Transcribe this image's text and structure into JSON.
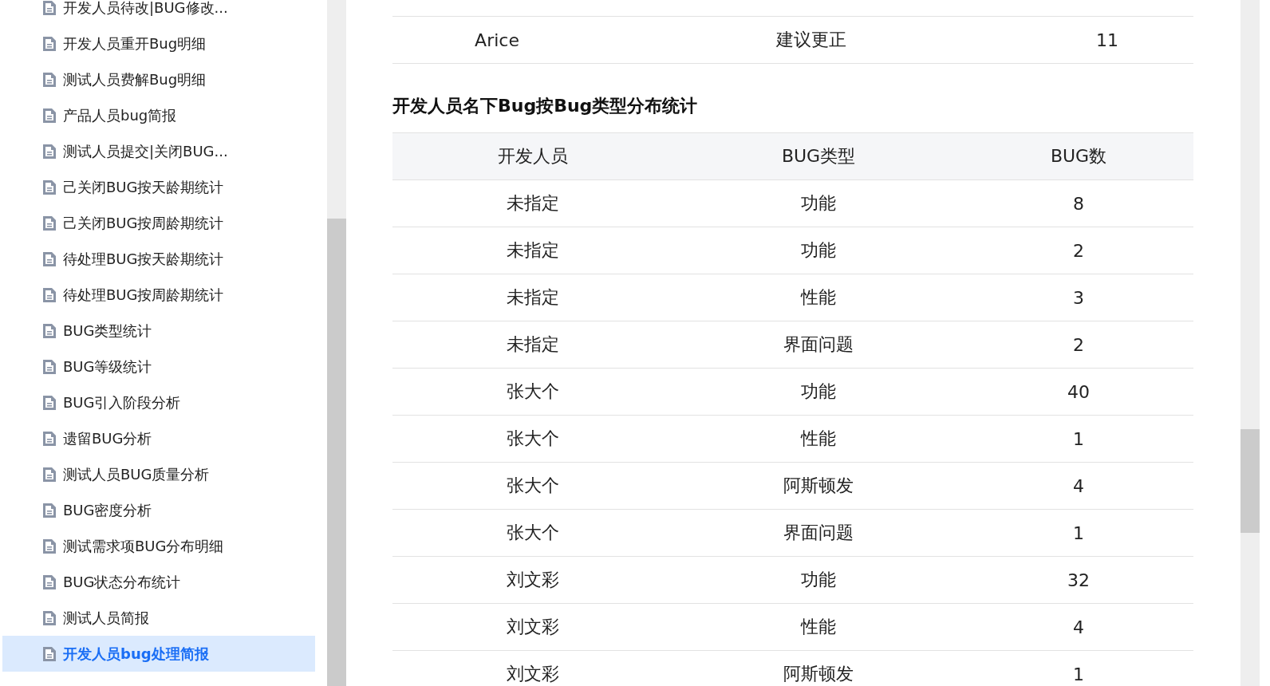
{
  "sidebar": {
    "items": [
      {
        "label": "开发人员待改|BUG修改...",
        "selected": false
      },
      {
        "label": "开发人员重开Bug明细",
        "selected": false
      },
      {
        "label": "测试人员费解Bug明细",
        "selected": false
      },
      {
        "label": "产品人员bug简报",
        "selected": false
      },
      {
        "label": "测试人员提交|关闭BUG...",
        "selected": false
      },
      {
        "label": "己关闭BUG按天龄期统计",
        "selected": false
      },
      {
        "label": "己关闭BUG按周龄期统计",
        "selected": false
      },
      {
        "label": "待处理BUG按天龄期统计",
        "selected": false
      },
      {
        "label": "待处理BUG按周龄期统计",
        "selected": false
      },
      {
        "label": "BUG类型统计",
        "selected": false
      },
      {
        "label": "BUG等级统计",
        "selected": false
      },
      {
        "label": "BUG引入阶段分析",
        "selected": false
      },
      {
        "label": "遗留BUG分析",
        "selected": false
      },
      {
        "label": "测试人员BUG质量分析",
        "selected": false
      },
      {
        "label": "BUG密度分析",
        "selected": false
      },
      {
        "label": "测试需求项BUG分布明细",
        "selected": false
      },
      {
        "label": "BUG状态分布统计",
        "selected": false
      },
      {
        "label": "测试人员简报",
        "selected": false
      },
      {
        "label": "开发人员bug处理简报",
        "selected": true
      }
    ]
  },
  "previous_table": {
    "rows": [
      [
        "Arice",
        "建议更正",
        "11"
      ]
    ]
  },
  "section": {
    "title": "开发人员名下Bug按Bug类型分布统计",
    "columns": [
      "开发人员",
      "BUG类型",
      "BUG数"
    ],
    "rows": [
      [
        "未指定",
        "功能",
        "8"
      ],
      [
        "未指定",
        "功能",
        "2"
      ],
      [
        "未指定",
        "性能",
        "3"
      ],
      [
        "未指定",
        "界面问题",
        "2"
      ],
      [
        "张大个",
        "功能",
        "40"
      ],
      [
        "张大个",
        "性能",
        "1"
      ],
      [
        "张大个",
        "阿斯顿发",
        "4"
      ],
      [
        "张大个",
        "界面问题",
        "1"
      ],
      [
        "刘文彩",
        "功能",
        "32"
      ],
      [
        "刘文彩",
        "性能",
        "4"
      ],
      [
        "刘文彩",
        "阿斯顿发",
        "1"
      ]
    ]
  }
}
